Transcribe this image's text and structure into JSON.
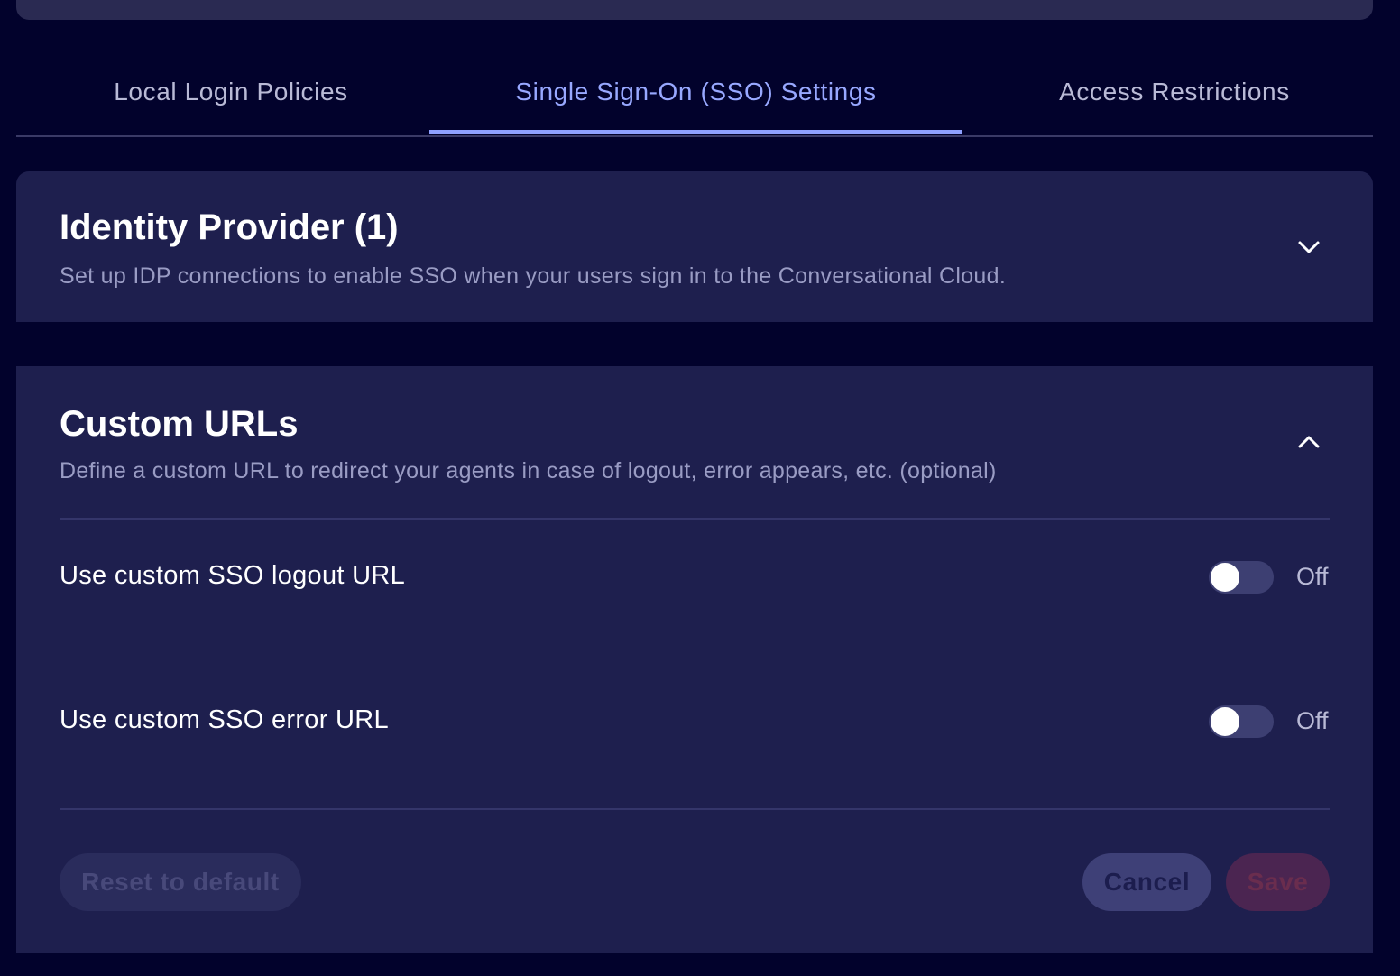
{
  "tabs": [
    {
      "label": "Local Login Policies"
    },
    {
      "label": "Single Sign-On (SSO) Settings",
      "active": true
    },
    {
      "label": "Access Restrictions"
    }
  ],
  "identity_provider": {
    "title": "Identity Provider (1)",
    "subtitle": "Set up IDP connections to enable SSO when your users sign in to the Conversational Cloud.",
    "expanded": false,
    "chevron_icon": "chevron-down-icon"
  },
  "custom_urls": {
    "title": "Custom URLs",
    "subtitle": "Define a custom URL to redirect your agents in case of logout, error appears, etc. (optional)",
    "expanded": true,
    "chevron_icon": "chevron-up-icon",
    "settings": [
      {
        "label": "Use custom SSO logout URL",
        "state": "Off",
        "enabled": false
      },
      {
        "label": "Use custom SSO error URL",
        "state": "Off",
        "enabled": false
      }
    ],
    "buttons": {
      "reset": "Reset to default",
      "cancel": "Cancel",
      "save": "Save"
    }
  },
  "colors": {
    "background": "#02022c",
    "card": "#1e1f4e",
    "accent": "#8ea0ff"
  }
}
